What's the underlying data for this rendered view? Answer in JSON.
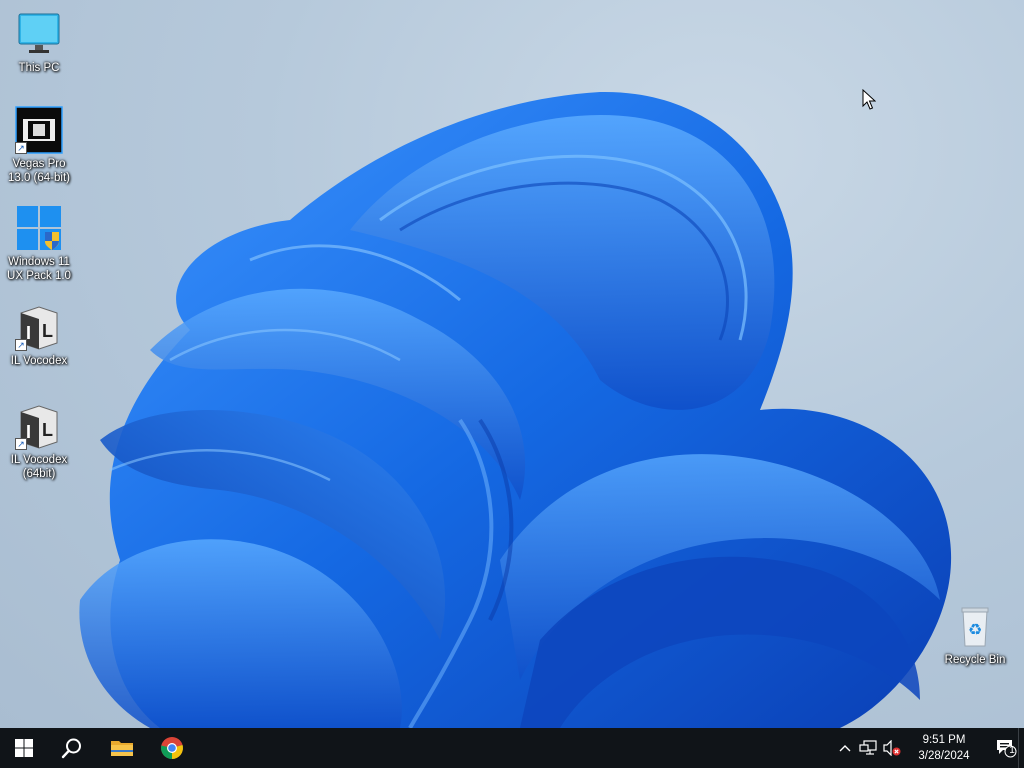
{
  "desktop": {
    "icons": [
      {
        "label": "This PC",
        "icon": "monitor-icon"
      },
      {
        "label": "Vegas Pro 13.0 (64-bit)",
        "icon": "film-icon"
      },
      {
        "label": "Windows 11 UX Pack 1.0",
        "icon": "windows-logo-icon"
      },
      {
        "label": "IL Vocodex",
        "icon": "il-vocodex-icon"
      },
      {
        "label": "IL Vocodex (64bit)",
        "icon": "il-vocodex-icon"
      },
      {
        "label": "Recycle Bin",
        "icon": "recycle-bin-icon"
      }
    ]
  },
  "taskbar": {
    "pinned": [
      {
        "name": "Start",
        "icon": "windows-start-icon"
      },
      {
        "name": "Search",
        "icon": "search-icon"
      },
      {
        "name": "File Explorer",
        "icon": "folder-icon"
      },
      {
        "name": "Google Chrome",
        "icon": "chrome-icon"
      }
    ],
    "tray": {
      "icons": [
        "chevron-up-icon",
        "network-icon",
        "volume-muted-icon"
      ],
      "time": "9:51 PM",
      "date": "3/28/2024",
      "notification_count": "1"
    }
  },
  "colors": {
    "taskbar_bg": "#101418",
    "wallpaper_bloom": "#1a6fe0",
    "desktop_bg": "#b6c9db"
  }
}
